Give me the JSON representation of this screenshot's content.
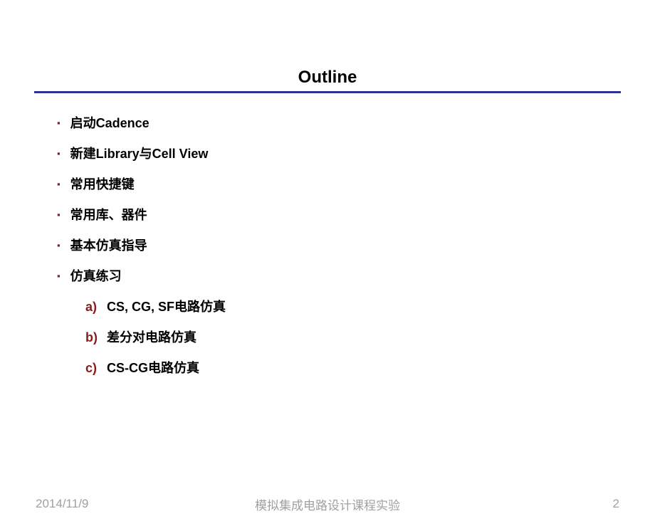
{
  "title": "Outline",
  "bullets": [
    "启动Cadence",
    "新建Library与Cell View",
    "常用快捷键",
    "常用库、器件",
    "基本仿真指导",
    "仿真练习"
  ],
  "sublist": [
    {
      "letter": "a)",
      "text": "CS, CG, SF电路仿真"
    },
    {
      "letter": "b)",
      "text": "差分对电路仿真"
    },
    {
      "letter": "c)",
      "text": "CS-CG电路仿真"
    }
  ],
  "footer": {
    "date": "2014/11/9",
    "center": "模拟集成电路设计课程实验",
    "page": "2"
  }
}
